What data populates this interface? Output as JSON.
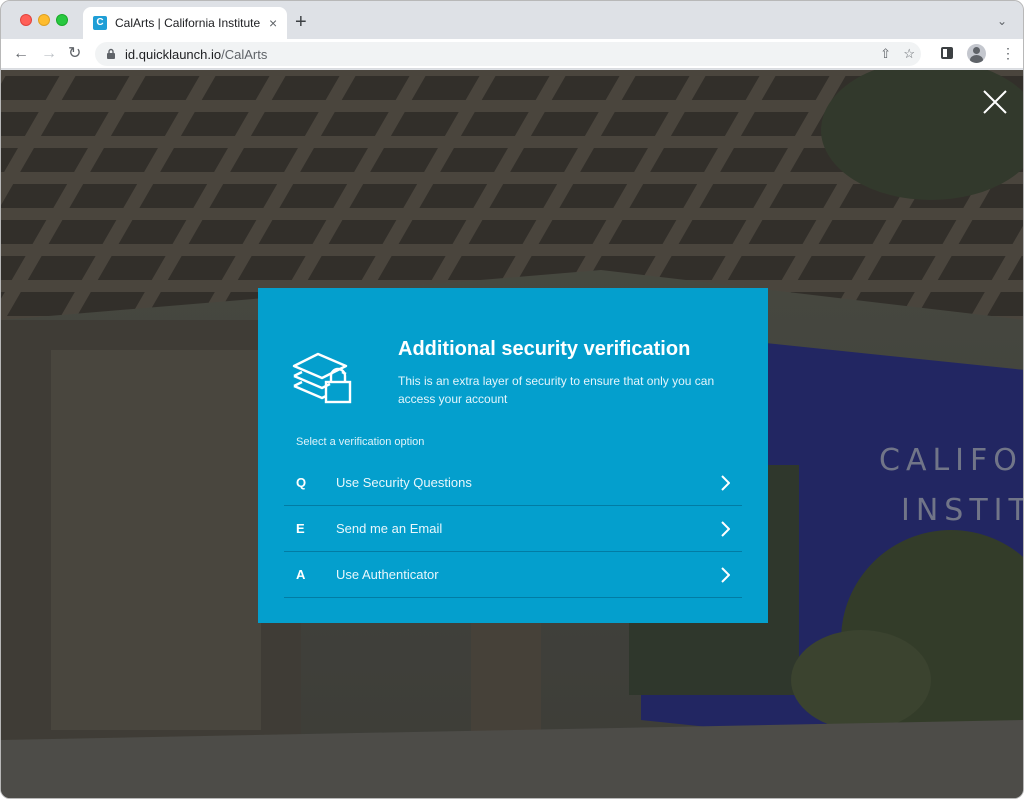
{
  "browser": {
    "tab": {
      "favicon_letter": "C",
      "title": "CalArts | California Institute of the Arts",
      "close": "×"
    },
    "new_tab": "+",
    "tab_menu": "⌄",
    "url_host": "id.quicklaunch.io",
    "url_path": "/CalArts"
  },
  "page": {
    "close_label": "Close"
  },
  "modal": {
    "title": "Additional security verification",
    "subtitle": "This is an extra layer of security to ensure that only you can access your account",
    "prompt": "Select a verification option",
    "options": [
      {
        "key": "Q",
        "label": "Use Security Questions"
      },
      {
        "key": "E",
        "label": "Send me an Email"
      },
      {
        "key": "A",
        "label": "Use Authenticator"
      }
    ]
  },
  "colors": {
    "modal_bg": "#049fcd",
    "accent": "#1e9ed6"
  }
}
